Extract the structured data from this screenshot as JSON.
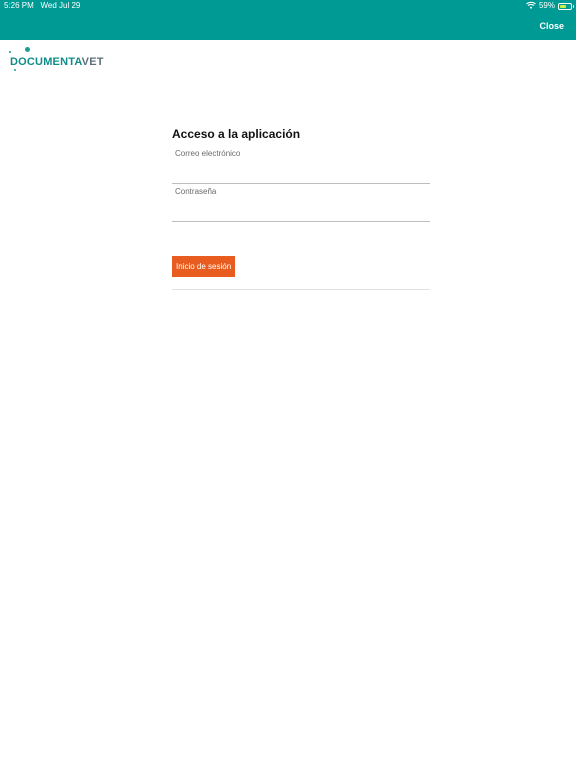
{
  "status_bar": {
    "time": "5:26 PM",
    "date": "Wed Jul 29",
    "battery": "59%",
    "battery_level": 0.59,
    "wifi_icon": "wifi-icon"
  },
  "header": {
    "close_label": "Close",
    "bar_color": "#009a94"
  },
  "logo": {
    "text_main": "DOCUMENTA",
    "text_accent": "VET"
  },
  "login": {
    "title": "Acceso a la aplicación",
    "email_label": "Correo electrónico",
    "email_value": "",
    "password_label": "Contraseña",
    "password_value": "",
    "submit_label": "Inicio de sesión",
    "button_color": "#e85d1f"
  }
}
